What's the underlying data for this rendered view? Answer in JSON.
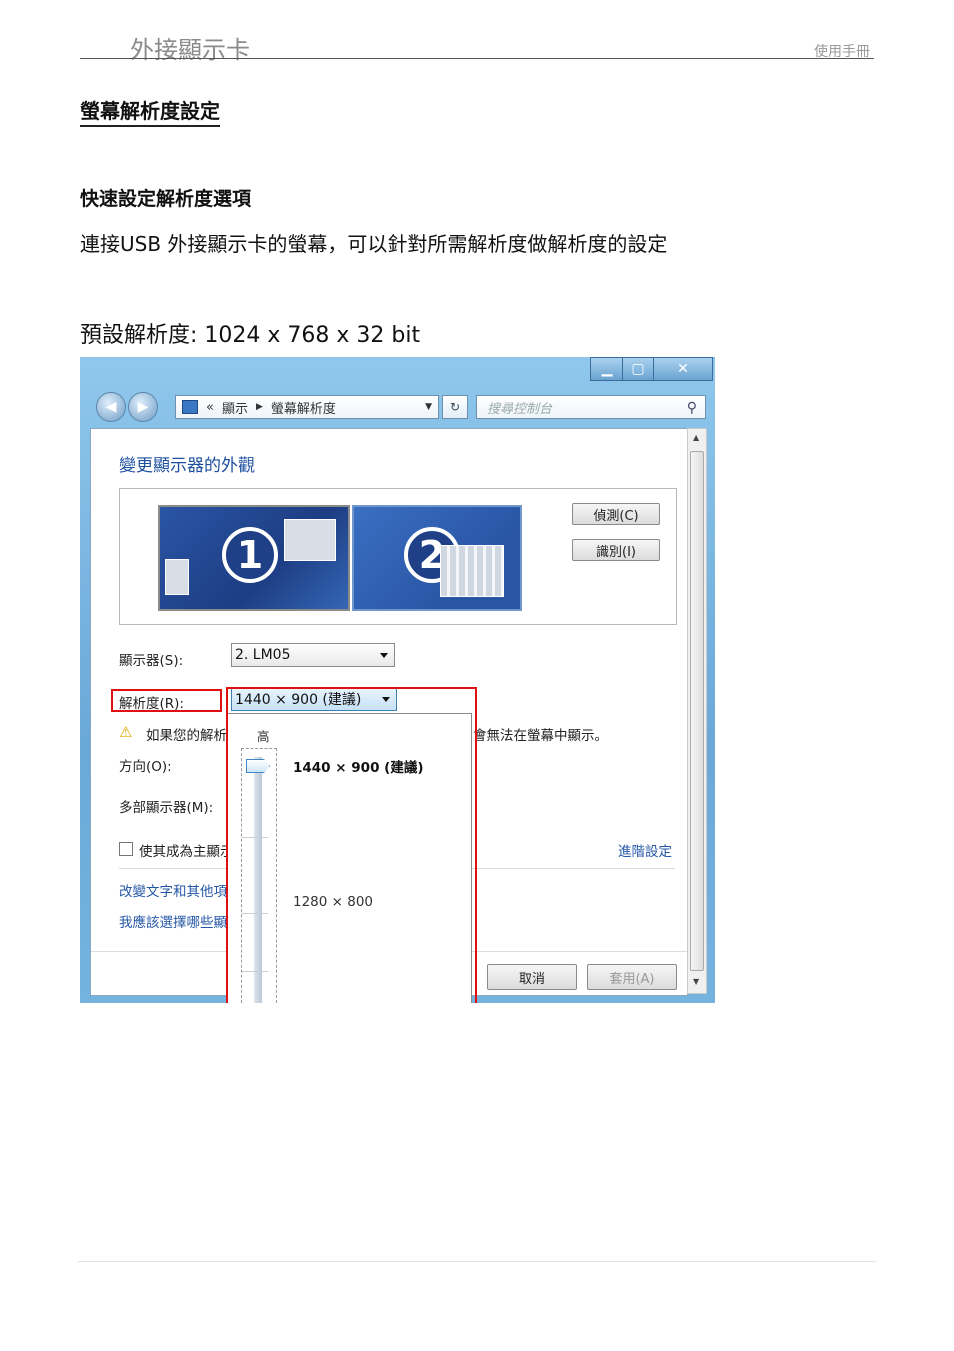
{
  "header": {
    "title": "外接顯示卡",
    "right": "使用手冊"
  },
  "section_title": "螢幕解析度設定",
  "subsection_title": "快速設定解析度選項",
  "body_text": "連接USB 外接顯示卡的螢幕，可以針對所需解析度做解析度的設定",
  "default_res": "預設解析度: 1024 x 768 x 32 bit",
  "window": {
    "titlebar": {
      "min": "▁",
      "max": "▢",
      "close": "✕"
    },
    "address": {
      "sep": "«",
      "crumb1": "顯示",
      "crumb2": "螢幕解析度"
    },
    "search_placeholder": "搜尋控制台",
    "heading": "變更顯示器的外觀",
    "monitor1": "1",
    "monitor2": "2",
    "detect_btn": "偵測(C)",
    "identify_btn": "識別(I)",
    "display_label": "顯示器(S):",
    "display_value": "2. LM05",
    "resolution_label": "解析度(R):",
    "resolution_value": "1440 × 900 (建議)",
    "warning_left": "如果您的解析",
    "warning_right": "會無法在螢幕中顯示。",
    "orientation_label": "方向(O):",
    "multi_label": "多部顯示器(M):",
    "primary_checkbox": "使其成為主顯示",
    "advanced_link": "進階設定",
    "link1": "改變文字和其他項",
    "link2": "我應該選擇哪些顯",
    "cancel_btn": "取消",
    "apply_btn": "套用(A)",
    "dropdown": {
      "high": "高",
      "opt1": "1440 × 900 (建議)",
      "opt2": "1280 × 800"
    }
  }
}
